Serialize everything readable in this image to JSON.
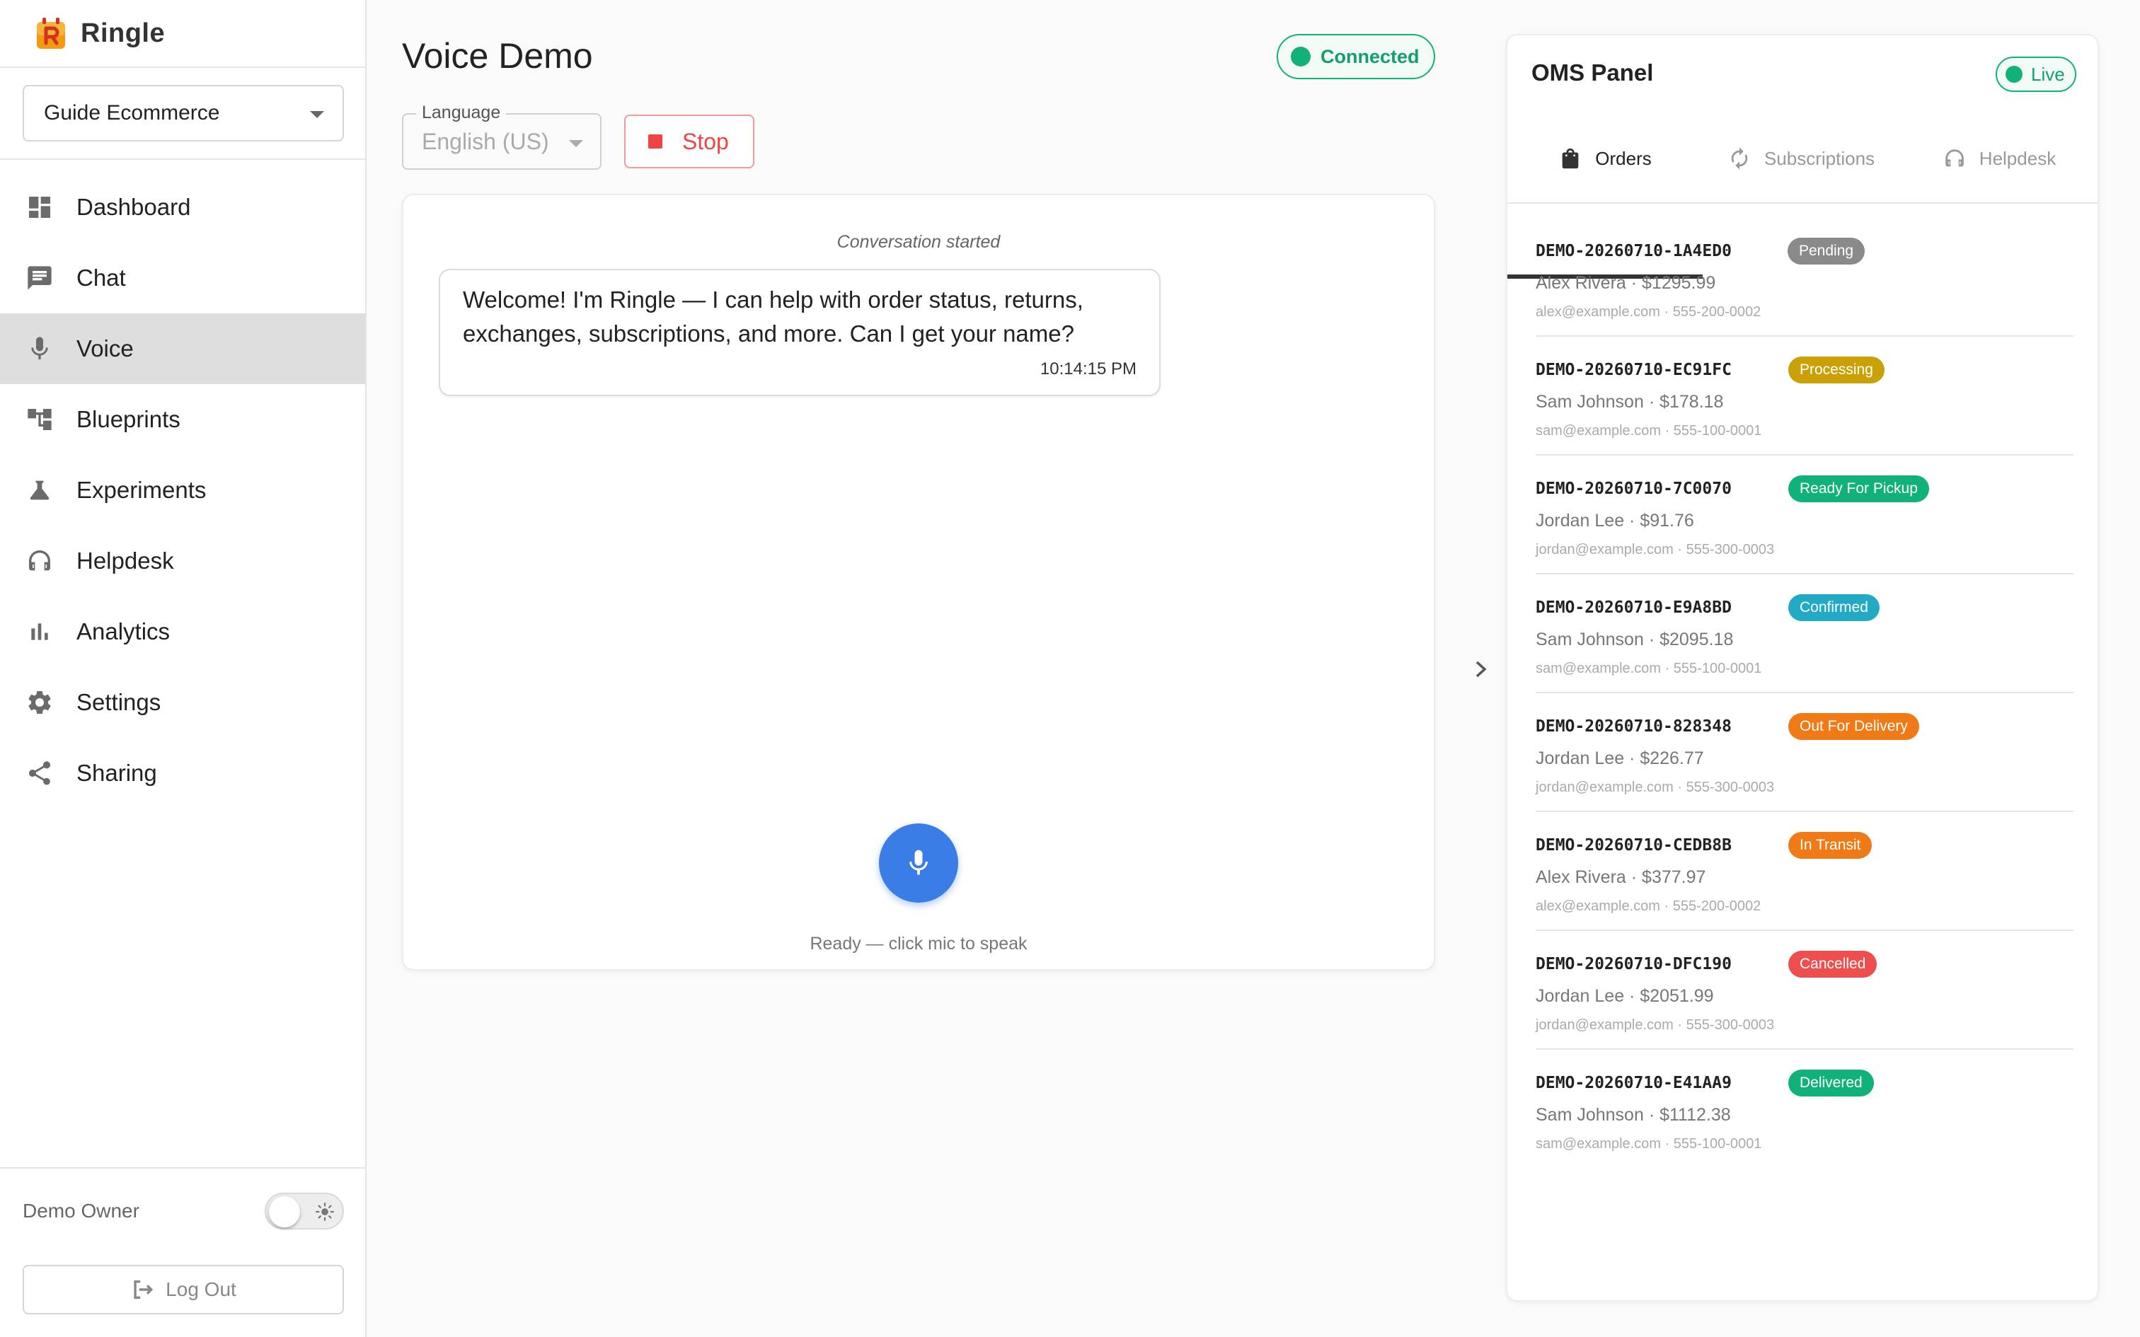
{
  "brand": {
    "name": "Ringle"
  },
  "workspace": {
    "selected": "Guide Ecommerce"
  },
  "nav": [
    {
      "label": "Dashboard",
      "icon": "dashboard-icon"
    },
    {
      "label": "Chat",
      "icon": "chat-icon"
    },
    {
      "label": "Voice",
      "icon": "mic-icon",
      "active": true
    },
    {
      "label": "Blueprints",
      "icon": "blueprint-icon"
    },
    {
      "label": "Experiments",
      "icon": "flask-icon"
    },
    {
      "label": "Helpdesk",
      "icon": "headset-icon"
    },
    {
      "label": "Analytics",
      "icon": "bar-chart-icon"
    },
    {
      "label": "Settings",
      "icon": "gear-icon"
    },
    {
      "label": "Sharing",
      "icon": "share-icon"
    }
  ],
  "user": {
    "name": "Demo Owner",
    "logout_label": "Log Out"
  },
  "main": {
    "title": "Voice Demo",
    "status": "Connected",
    "language_label": "Language",
    "language_value": "English (US)",
    "stop_label": "Stop",
    "conversation_started": "Conversation started",
    "message": {
      "text": "Welcome! I'm Ringle — I can help with order status, returns, exchanges, subscriptions, and more. Can I get your name?",
      "time": "10:14:15 PM"
    },
    "ready_text": "Ready — click mic to speak"
  },
  "oms": {
    "title": "OMS Panel",
    "live_label": "Live",
    "tabs": [
      "Orders",
      "Subscriptions",
      "Helpdesk"
    ],
    "orders": [
      {
        "id": "DEMO-20260710-1A4ED0",
        "status": "Pending",
        "status_color": "#8a8a8a",
        "customer": "Alex Rivera · $1295.99",
        "contact": "alex@example.com · 555-200-0002"
      },
      {
        "id": "DEMO-20260710-EC91FC",
        "status": "Processing",
        "status_color": "#c9a106",
        "customer": "Sam Johnson · $178.18",
        "contact": "sam@example.com · 555-100-0001"
      },
      {
        "id": "DEMO-20260710-7C0070",
        "status": "Ready For Pickup",
        "status_color": "#10b27a",
        "customer": "Jordan Lee · $91.76",
        "contact": "jordan@example.com · 555-300-0003"
      },
      {
        "id": "DEMO-20260710-E9A8BD",
        "status": "Confirmed",
        "status_color": "#22aac4",
        "customer": "Sam Johnson · $2095.18",
        "contact": "sam@example.com · 555-100-0001"
      },
      {
        "id": "DEMO-20260710-828348",
        "status": "Out For Delivery",
        "status_color": "#f07a16",
        "customer": "Jordan Lee · $226.77",
        "contact": "jordan@example.com · 555-300-0003"
      },
      {
        "id": "DEMO-20260710-CEDB8B",
        "status": "In Transit",
        "status_color": "#f07a16",
        "customer": "Alex Rivera · $377.97",
        "contact": "alex@example.com · 555-200-0002"
      },
      {
        "id": "DEMO-20260710-DFC190",
        "status": "Cancelled",
        "status_color": "#ef4e4e",
        "customer": "Jordan Lee · $2051.99",
        "contact": "jordan@example.com · 555-300-0003"
      },
      {
        "id": "DEMO-20260710-E41AA9",
        "status": "Delivered",
        "status_color": "#10b27a",
        "customer": "Sam Johnson · $1112.38",
        "contact": "sam@example.com · 555-100-0001"
      }
    ]
  },
  "colors": {
    "accent": "#3b7de6",
    "success": "#10b27a",
    "danger": "#ef4444"
  }
}
